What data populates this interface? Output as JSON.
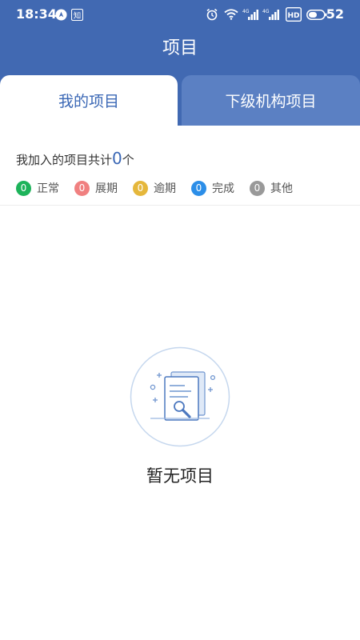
{
  "status_bar": {
    "time": "18:34",
    "battery": "52",
    "left_icons": [
      "navigation-app-icon",
      "zhihu-app-icon"
    ],
    "right_icons": [
      "alarm-icon",
      "wifi-icon",
      "signal-4g-icon",
      "signal-4g-icon",
      "hd-icon",
      "battery-icon"
    ],
    "zhihu_glyph": "知"
  },
  "header": {
    "title": "项目",
    "color": "#4169b2"
  },
  "tabs": [
    {
      "label": "我的项目",
      "active": true
    },
    {
      "label": "下级机构项目",
      "active": false
    }
  ],
  "summary": {
    "prefix": "我加入的项目共计",
    "count": "0",
    "suffix": "个"
  },
  "legend": [
    {
      "count": "0",
      "label": "正常",
      "color": "#1db35a"
    },
    {
      "count": "0",
      "label": "展期",
      "color": "#f08080"
    },
    {
      "count": "0",
      "label": "逾期",
      "color": "#e5b73b"
    },
    {
      "count": "0",
      "label": "完成",
      "color": "#2c8ee8"
    },
    {
      "count": "0",
      "label": "其他",
      "color": "#999999"
    }
  ],
  "empty": {
    "text": "暂无项目",
    "icon": "empty-document-search-icon"
  }
}
